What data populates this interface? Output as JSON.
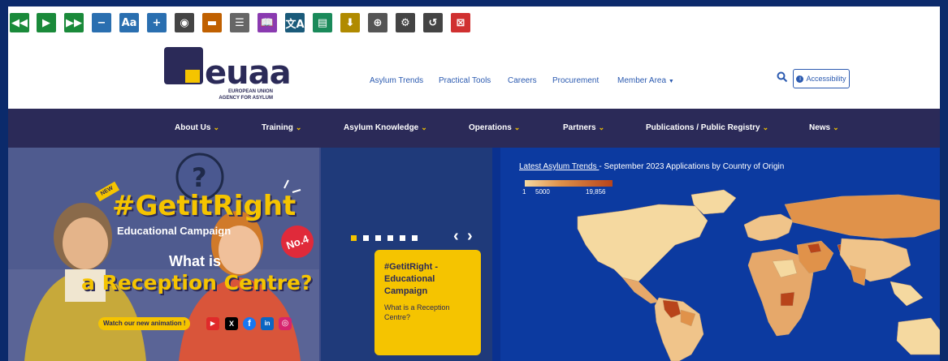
{
  "toolbar": {
    "buttons": [
      {
        "name": "rewind",
        "glyph": "◀◀",
        "color": "#1a8a3a"
      },
      {
        "name": "play",
        "glyph": "▶",
        "color": "#1a8a3a"
      },
      {
        "name": "fast-forward",
        "glyph": "▶▶",
        "color": "#1a8a3a"
      },
      {
        "name": "minus",
        "glyph": "−",
        "color": "#2a6fb0"
      },
      {
        "name": "text-size",
        "glyph": "Aa",
        "color": "#2a6fb0"
      },
      {
        "name": "plus",
        "glyph": "+",
        "color": "#2a6fb0"
      },
      {
        "name": "color-wheel",
        "glyph": "◉",
        "color": "#444"
      },
      {
        "name": "ruler",
        "glyph": "▬",
        "color": "#c06000"
      },
      {
        "name": "mask",
        "glyph": "☰",
        "color": "#666"
      },
      {
        "name": "dictionary",
        "glyph": "📖",
        "color": "#8a3ab0"
      },
      {
        "name": "translate",
        "glyph": "文A",
        "color": "#1a5a7a"
      },
      {
        "name": "text-reader",
        "glyph": "▤",
        "color": "#1a8a5a"
      },
      {
        "name": "download",
        "glyph": "⬇",
        "color": "#b08a00"
      },
      {
        "name": "zoom",
        "glyph": "⊕",
        "color": "#555"
      },
      {
        "name": "settings",
        "glyph": "⚙",
        "color": "#444"
      },
      {
        "name": "reset",
        "glyph": "↺",
        "color": "#444"
      },
      {
        "name": "close",
        "glyph": "⊠",
        "color": "#d03030"
      }
    ]
  },
  "header": {
    "logo_text": "euaa",
    "logo_sub_line1": "EUROPEAN UNION",
    "logo_sub_line2": "AGENCY FOR ASYLUM",
    "links": [
      "Asylum Trends",
      "Practical Tools",
      "Careers",
      "Procurement",
      "Member Area"
    ],
    "accessibility_label": "Accessibility"
  },
  "nav": {
    "items": [
      "About Us",
      "Training",
      "Asylum Knowledge",
      "Operations",
      "Partners",
      "Publications / Public Registry",
      "News"
    ]
  },
  "hero": {
    "campaign_tag": "NEW",
    "campaign_hashtag": "#GetitRight",
    "campaign_subtitle": "Educational Campaign",
    "campaign_badge": "No.4",
    "question_line1": "What is",
    "question_line2": "a Reception Centre?",
    "watch_label": "Watch our new animation !",
    "social": [
      "▶",
      "X",
      "f",
      "in",
      "◎"
    ],
    "card_title": "#GetitRight - Educational Campaign",
    "card_text": "What is a Reception Centre?",
    "carousel_prev": "‹",
    "carousel_next": "›"
  },
  "map": {
    "title_link": "Latest Asylum Trends ",
    "title_rest": "- September 2023 Applications by Country of Origin",
    "legend_values": [
      "1",
      "5000",
      "19,856"
    ],
    "colors": {
      "light": "#f5d9a0",
      "mid": "#e0924a",
      "dark": "#b8441a",
      "ocean": "#0c3aa0"
    }
  }
}
